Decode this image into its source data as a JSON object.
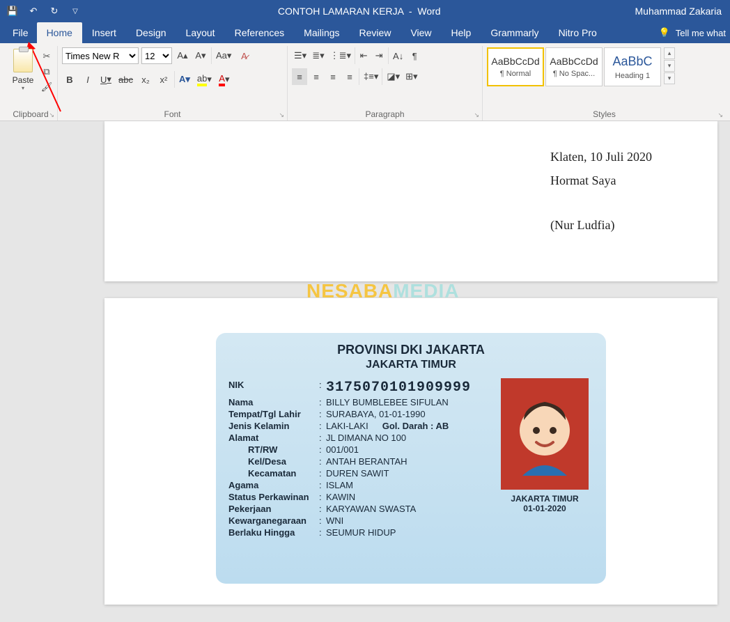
{
  "title": {
    "doc": "CONTOH LAMARAN KERJA",
    "app": "Word",
    "user": "Muhammad Zakaria"
  },
  "tabs": {
    "file": "File",
    "home": "Home",
    "insert": "Insert",
    "design": "Design",
    "layout": "Layout",
    "references": "References",
    "mailings": "Mailings",
    "review": "Review",
    "view": "View",
    "help": "Help",
    "grammarly": "Grammarly",
    "nitro": "Nitro Pro",
    "tell": "Tell me what"
  },
  "ribbon": {
    "clipboard": {
      "paste": "Paste",
      "label": "Clipboard"
    },
    "font": {
      "name": "Times New R",
      "size": "12",
      "bold": "B",
      "italic": "I",
      "underline": "U",
      "strike": "abc",
      "sub": "x₂",
      "sup": "x²",
      "label": "Font"
    },
    "paragraph": {
      "label": "Paragraph"
    },
    "styles": {
      "label": "Styles",
      "items": [
        {
          "sample": "AaBbCcDd",
          "name": "¶ Normal"
        },
        {
          "sample": "AaBbCcDd",
          "name": "¶ No Spac..."
        },
        {
          "sample": "AaBbC",
          "name": "Heading 1"
        }
      ]
    }
  },
  "doc": {
    "date": "Klaten, 10 Juli 2020",
    "salute": "Hormat Saya",
    "name": "(Nur Ludfia)"
  },
  "wm": {
    "a": "NESABA",
    "b": "MEDIA"
  },
  "ktp": {
    "prov": "PROVINSI DKI JAKARTA",
    "city": "JAKARTA TIMUR",
    "labels": {
      "nik": "NIK",
      "nama": "Nama",
      "ttl": "Tempat/Tgl Lahir",
      "jk": "Jenis Kelamin",
      "gol": "Gol. Darah :",
      "alamat": "Alamat",
      "rtrw": "RT/RW",
      "keldesa": "Kel/Desa",
      "kec": "Kecamatan",
      "agama": "Agama",
      "status": "Status Perkawinan",
      "pekerjaan": "Pekerjaan",
      "kwn": "Kewarganegaraan",
      "berlaku": "Berlaku Hingga"
    },
    "vals": {
      "nik": "3175070101909999",
      "nama": "BILLY BUMBLEBEE SIFULAN",
      "ttl": "SURABAYA, 01-01-1990",
      "jk": "LAKI-LAKI",
      "gol": "AB",
      "alamat": "JL DIMANA NO 100",
      "rtrw": "001/001",
      "keldesa": "ANTAH BERANTAH",
      "kec": "DUREN SAWIT",
      "agama": "ISLAM",
      "status": "KAWIN",
      "pekerjaan": "KARYAWAN SWASTA",
      "kwn": "WNI",
      "berlaku": "SEUMUR HIDUP"
    },
    "issue": {
      "place": "JAKARTA TIMUR",
      "date": "01-01-2020"
    }
  }
}
